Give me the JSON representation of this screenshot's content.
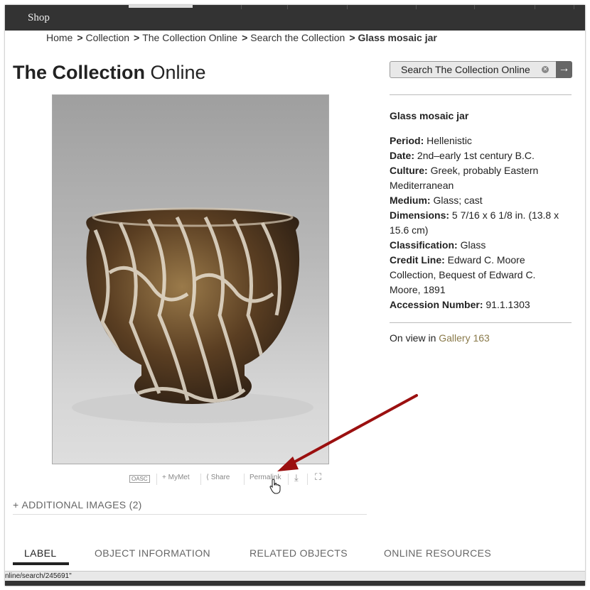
{
  "topnav": {
    "shop_label": "Shop"
  },
  "breadcrumb": {
    "items": [
      "Home",
      "Collection",
      "The Collection Online",
      "Search the Collection"
    ],
    "separator": ">",
    "current": "Glass mosaic jar"
  },
  "page_title": {
    "bold": "The Collection",
    "light": " Online"
  },
  "search": {
    "placeholder": "Search The Collection Online",
    "clear_icon": "clear-icon",
    "go_icon": "arrow-right-icon"
  },
  "object": {
    "title": "Glass mosaic jar",
    "fields": [
      {
        "label": "Period:",
        "value": "Hellenistic"
      },
      {
        "label": "Date:",
        "value": "2nd–early 1st century B.C."
      },
      {
        "label": "Culture:",
        "value": "Greek, probably Eastern Mediterranean"
      },
      {
        "label": "Medium:",
        "value": "Glass; cast"
      },
      {
        "label": "Dimensions:",
        "value": "5 7/16 x 6 1/8 in. (13.8 x 15.6 cm)"
      },
      {
        "label": "Classification:",
        "value": "Glass"
      },
      {
        "label": "Credit Line:",
        "value": "Edward C. Moore Collection, Bequest of Edward C. Moore, 1891"
      },
      {
        "label": "Accession Number:",
        "value": "91.1.1303"
      }
    ],
    "on_view_prefix": "On view in ",
    "gallery_link": "Gallery 163"
  },
  "image_tools": {
    "oasc": "OASC",
    "mymet": "MyMet",
    "share": "Share",
    "permalink": "Permalink"
  },
  "additional_images": {
    "plus": "+",
    "label": "ADDITIONAL IMAGES (2)"
  },
  "tabs": [
    {
      "label": "LABEL",
      "active": true
    },
    {
      "label": "OBJECT INFORMATION",
      "active": false
    },
    {
      "label": "RELATED OBJECTS",
      "active": false
    },
    {
      "label": "ONLINE RESOURCES",
      "active": false
    }
  ],
  "status_bar": {
    "url": "nline/search/245691\""
  },
  "colors": {
    "accent_link": "#8a7a4a",
    "annotation_arrow": "#9b1010",
    "topbar": "#333333"
  }
}
